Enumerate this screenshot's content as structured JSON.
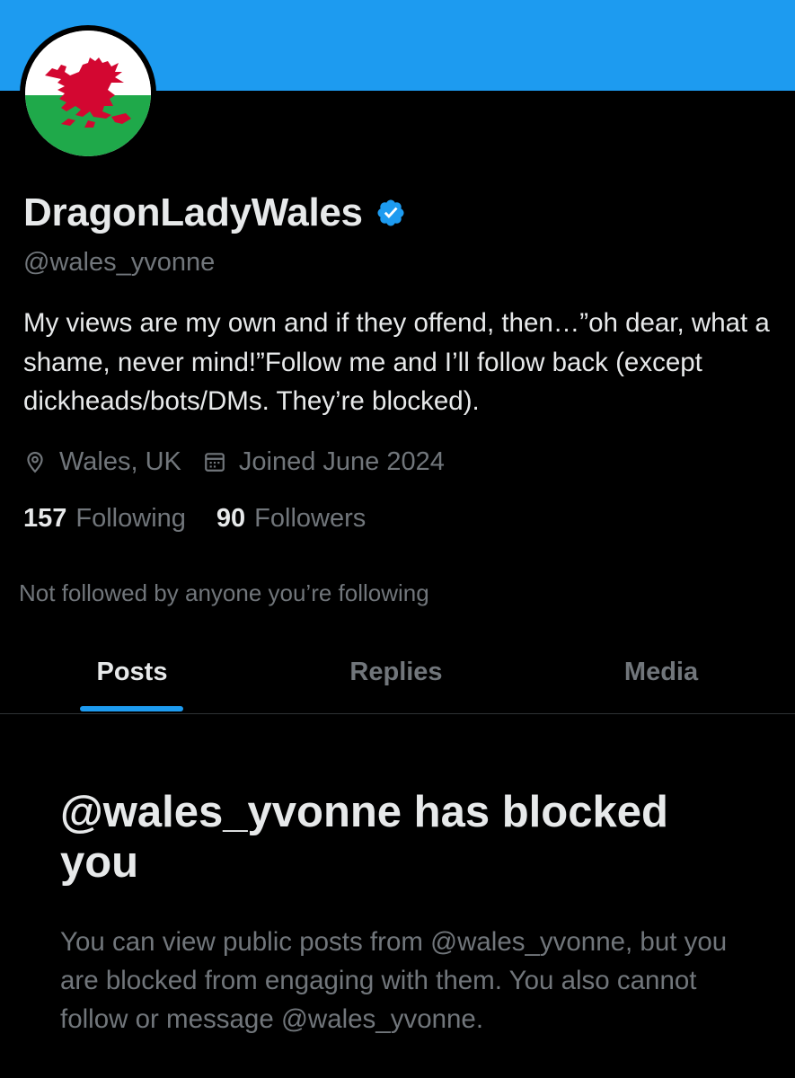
{
  "profile": {
    "display_name": "DragonLadyWales",
    "verified": true,
    "handle": "@wales_yvonne",
    "bio": "My views are my own and if they offend, then…”oh dear, what a shame, never mind!”Follow me and I’ll follow back (except dickheads/bots/DMs. They’re blocked).",
    "location": "Wales, UK",
    "joined": "Joined June 2024",
    "avatar": "welsh-flag"
  },
  "stats": {
    "following_count": "157",
    "following_label": "Following",
    "followers_count": "90",
    "followers_label": "Followers"
  },
  "not_followed_text": "Not followed by anyone you’re following",
  "tabs": [
    {
      "label": "Posts",
      "active": true
    },
    {
      "label": "Replies",
      "active": false
    },
    {
      "label": "Media",
      "active": false
    }
  ],
  "blocked": {
    "title": "@wales_yvonne has blocked you",
    "body": "You can view public posts from @wales_yvonne, but you are blocked from engaging with them. You also cannot follow or message @wales_yvonne."
  },
  "colors": {
    "background": "#000000",
    "accent": "#1d9bf0",
    "primary_text": "#e7e9ea",
    "secondary_text": "#71767b",
    "flag_green": "#1fa94a",
    "flag_red": "#d30731"
  },
  "icons": [
    "verified-badge-icon",
    "location-pin-icon",
    "calendar-icon"
  ]
}
